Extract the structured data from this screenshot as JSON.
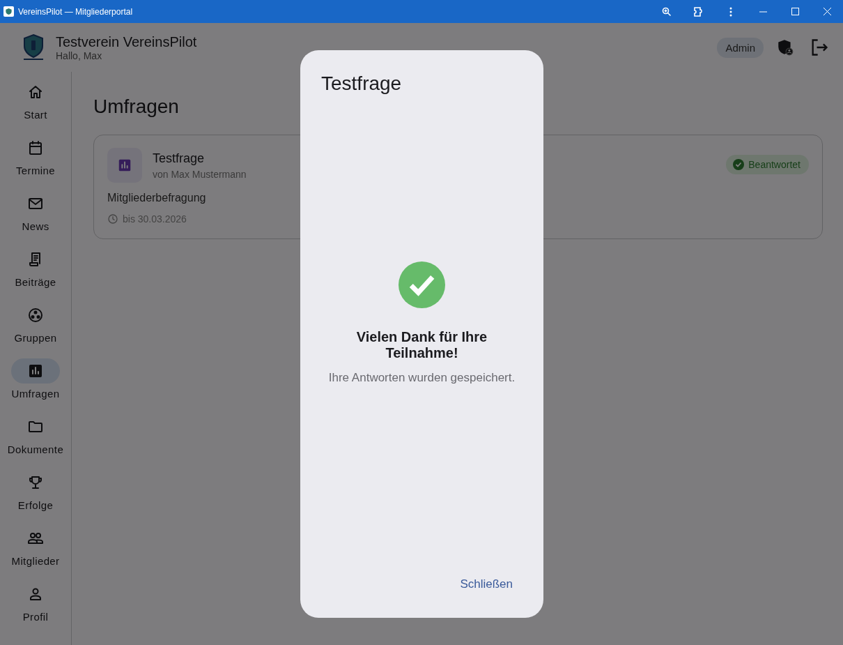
{
  "window": {
    "title": "VereinsPilot — Mitgliederportal"
  },
  "header": {
    "title": "Testverein VereinsPilot",
    "greeting": "Hallo, Max",
    "role_badge": "Admin"
  },
  "sidebar": {
    "items": [
      {
        "label": "Start",
        "selected": false
      },
      {
        "label": "Termine",
        "selected": false
      },
      {
        "label": "News",
        "selected": false
      },
      {
        "label": "Beiträge",
        "selected": false
      },
      {
        "label": "Gruppen",
        "selected": false
      },
      {
        "label": "Umfragen",
        "selected": true
      },
      {
        "label": "Dokumente",
        "selected": false
      },
      {
        "label": "Erfolge",
        "selected": false
      },
      {
        "label": "Mitglieder",
        "selected": false
      },
      {
        "label": "Profil",
        "selected": false
      }
    ]
  },
  "page": {
    "title": "Umfragen",
    "surveys": [
      {
        "title": "Testfrage",
        "author": "von Max Mustermann",
        "category": "Mitgliederbefragung",
        "deadline": "bis 30.03.2026",
        "status": "Beantwortet",
        "answered": true
      }
    ]
  },
  "dialog": {
    "title": "Testfrage",
    "message": "Vielen Dank für Ihre Teilnahme!",
    "detail": "Ihre Antworten wurden gespeichert.",
    "button": "Schließen"
  }
}
